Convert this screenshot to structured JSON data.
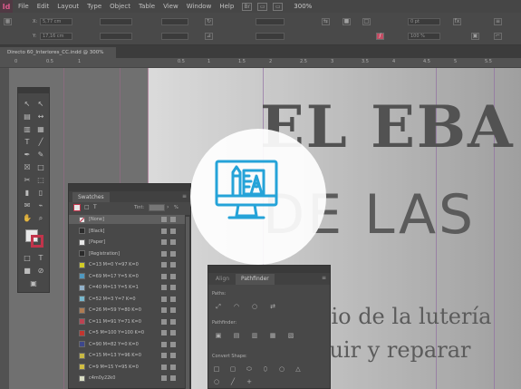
{
  "app": {
    "logo": "Id"
  },
  "menu": [
    "File",
    "Edit",
    "Layout",
    "Type",
    "Object",
    "Table",
    "View",
    "Window",
    "Help"
  ],
  "menubar": {
    "bridge_label": "Br",
    "zoom": "300%"
  },
  "control": {
    "x_value": "5,77 cm",
    "y_value": "17,16 cm",
    "weight_value": "0 pt",
    "percent_value": "100 %"
  },
  "document": {
    "tab_title": "Directo 60_Interiores_CC.indd @ 300%"
  },
  "ruler": {
    "labels": [
      "0",
      "0.5",
      "1",
      "0.5",
      "1",
      "1.5",
      "2",
      "2.5",
      "3",
      "3.5",
      "4",
      "4.5",
      "5",
      "5.5"
    ]
  },
  "hero": {
    "line1": "EL EBA",
    "line2": "DE LAS",
    "body1": "cio de la lutería",
    "body2": "ruir y reparar"
  },
  "tools": [
    {
      "name": "selection-tool-icon",
      "glyph": "↖"
    },
    {
      "name": "direct-selection-tool-icon",
      "glyph": "↖"
    },
    {
      "name": "page-tool-icon",
      "glyph": "▤"
    },
    {
      "name": "gap-tool-icon",
      "glyph": "↔"
    },
    {
      "name": "content-collector-icon",
      "glyph": "▥"
    },
    {
      "name": "content-placer-icon",
      "glyph": "▦"
    },
    {
      "name": "type-tool-icon",
      "glyph": "T"
    },
    {
      "name": "line-tool-icon",
      "glyph": "╱"
    },
    {
      "name": "pen-tool-icon",
      "glyph": "✒"
    },
    {
      "name": "pencil-tool-icon",
      "glyph": "✎"
    },
    {
      "name": "rectangle-frame-tool-icon",
      "glyph": "☒"
    },
    {
      "name": "rectangle-tool-icon",
      "glyph": "□"
    },
    {
      "name": "scissors-tool-icon",
      "glyph": "✂"
    },
    {
      "name": "free-transform-tool-icon",
      "glyph": "⬚"
    },
    {
      "name": "gradient-swatch-tool-icon",
      "glyph": "▮"
    },
    {
      "name": "gradient-feather-tool-icon",
      "glyph": "▯"
    },
    {
      "name": "note-tool-icon",
      "glyph": "✉"
    },
    {
      "name": "eyedropper-tool-icon",
      "glyph": "⌁"
    },
    {
      "name": "hand-tool-icon",
      "glyph": "✋"
    },
    {
      "name": "zoom-tool-icon",
      "glyph": "⌕"
    }
  ],
  "swatches": {
    "title": "Swatches",
    "tint_label": "Tint:",
    "tint_value": "",
    "tint_unit": "%",
    "items": [
      {
        "name": "[None]",
        "color": "#ffffff"
      },
      {
        "name": "[Black]",
        "color": "#1a1a1a"
      },
      {
        "name": "[Paper]",
        "color": "#ffffff"
      },
      {
        "name": "[Registration]",
        "color": "#1a1a1a"
      },
      {
        "name": "C=13 M=0 Y=97 K=0",
        "color": "#e8e000"
      },
      {
        "name": "C=69 M=17 Y=5 K=0",
        "color": "#3ea0d6"
      },
      {
        "name": "C=40 M=13 Y=5 K=1",
        "color": "#93bfe0"
      },
      {
        "name": "C=52 M=3 Y=7 K=0",
        "color": "#6fc7e6"
      },
      {
        "name": "C=26 M=59 Y=80 K=0",
        "color": "#c07a45"
      },
      {
        "name": "C=11 M=91 Y=71 K=0",
        "color": "#d83448"
      },
      {
        "name": "C=5 M=100 Y=100 K=0",
        "color": "#e2231a"
      },
      {
        "name": "C=90 M=82 Y=0 K=0",
        "color": "#2f3c99"
      },
      {
        "name": "C=15 M=13 Y=96 K=0",
        "color": "#dcc92a"
      },
      {
        "name": "C=9 M=15 Y=95 K=0",
        "color": "#e8cf26"
      },
      {
        "name": "c4m0y22k0",
        "color": "#eef3d0"
      }
    ]
  },
  "pathfinder": {
    "tabs": [
      "Align",
      "Pathfinder"
    ],
    "paths_label": "Paths:",
    "pathfinder_label": "Pathfinder:",
    "convert_label": "Convert Shape:"
  },
  "colors": {
    "accent": "#1aa6e0",
    "app_accent": "#ff4f93"
  }
}
